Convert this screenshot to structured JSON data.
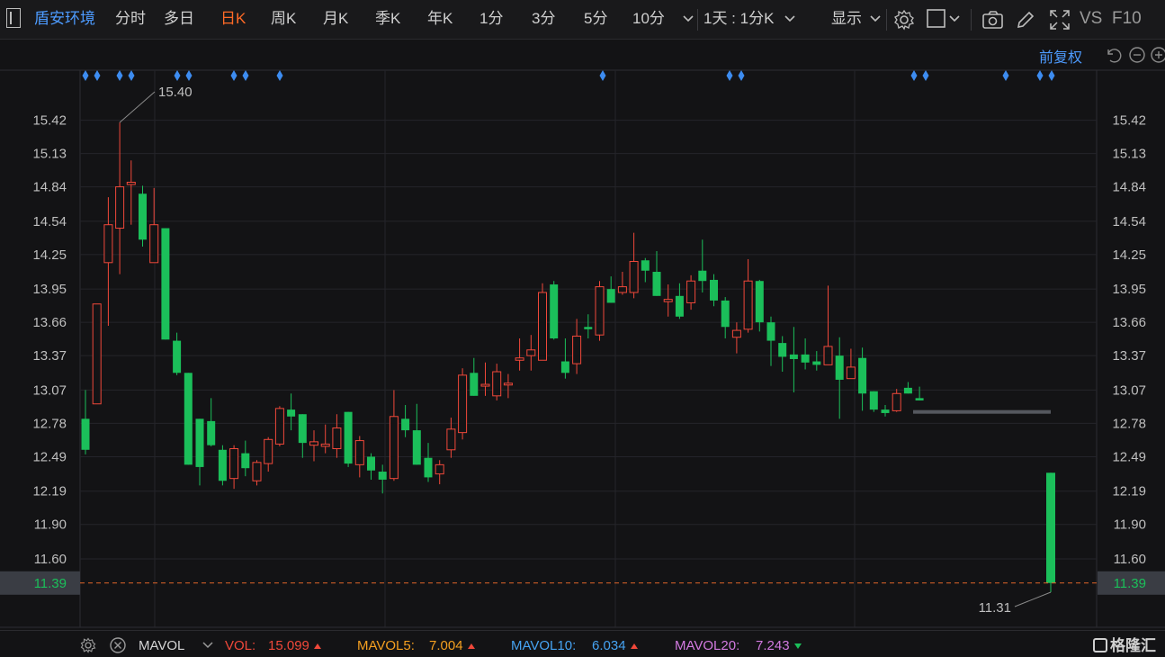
{
  "toolbar": {
    "stock_name": "盾安环境",
    "tabs": [
      "分时",
      "多日",
      "日K",
      "周K",
      "月K",
      "季K",
      "年K",
      "1分",
      "3分",
      "5分",
      "10分"
    ],
    "active_tab": "日K",
    "period_select": "1天 : 1分K",
    "display_label": "显示",
    "vs_label": "VS",
    "f10_label": "F10",
    "adjust_label": "前复权"
  },
  "chart_data": {
    "type": "candlestick",
    "ylim": [
      11.31,
      15.55
    ],
    "yticks": [
      "15.42",
      "15.13",
      "14.84",
      "14.54",
      "14.25",
      "13.95",
      "13.66",
      "13.37",
      "13.07",
      "12.78",
      "12.49",
      "12.19",
      "11.90",
      "11.60"
    ],
    "high_label": "15.40",
    "low_label": "11.31",
    "current_price_label": "11.39",
    "current_price": 11.39,
    "candles": [
      [
        12.82,
        12.55,
        13.07,
        12.51
      ],
      [
        12.95,
        13.82,
        13.82,
        12.95
      ],
      [
        14.18,
        14.51,
        14.75,
        13.63
      ],
      [
        14.48,
        14.84,
        15.4,
        14.08
      ],
      [
        14.86,
        14.88,
        15.07,
        14.51
      ],
      [
        14.78,
        14.38,
        14.85,
        14.32
      ],
      [
        14.18,
        14.51,
        14.83,
        14.18
      ],
      [
        14.48,
        13.51,
        14.48,
        13.51
      ],
      [
        13.5,
        13.22,
        13.57,
        13.2
      ],
      [
        13.22,
        12.42,
        13.22,
        12.42
      ],
      [
        12.82,
        12.4,
        12.82,
        12.24
      ],
      [
        12.8,
        12.59,
        13.0,
        12.58
      ],
      [
        12.55,
        12.28,
        12.59,
        12.24
      ],
      [
        12.3,
        12.56,
        12.59,
        12.21
      ],
      [
        12.52,
        12.39,
        12.63,
        12.32
      ],
      [
        12.28,
        12.44,
        12.46,
        12.24
      ],
      [
        12.43,
        12.64,
        12.66,
        12.36
      ],
      [
        12.6,
        12.91,
        12.93,
        12.58
      ],
      [
        12.9,
        12.84,
        13.04,
        12.72
      ],
      [
        12.86,
        12.61,
        12.86,
        12.48
      ],
      [
        12.59,
        12.62,
        12.72,
        12.45
      ],
      [
        12.58,
        12.6,
        12.77,
        12.52
      ],
      [
        12.56,
        12.74,
        12.86,
        12.48
      ],
      [
        12.88,
        12.43,
        12.88,
        12.4
      ],
      [
        12.42,
        12.63,
        12.67,
        12.31
      ],
      [
        12.49,
        12.37,
        12.52,
        12.29
      ],
      [
        12.36,
        12.29,
        12.42,
        12.17
      ],
      [
        12.3,
        12.84,
        13.07,
        12.28
      ],
      [
        12.82,
        12.72,
        12.94,
        12.66
      ],
      [
        12.72,
        12.42,
        12.95,
        12.42
      ],
      [
        12.48,
        12.31,
        12.61,
        12.27
      ],
      [
        12.34,
        12.42,
        12.46,
        12.25
      ],
      [
        12.55,
        12.73,
        12.83,
        12.48
      ],
      [
        12.7,
        13.2,
        13.26,
        12.64
      ],
      [
        13.22,
        13.02,
        13.35,
        13.02
      ],
      [
        13.12,
        13.12,
        13.31,
        13.02
      ],
      [
        13.02,
        13.23,
        13.3,
        12.98
      ],
      [
        13.12,
        13.13,
        13.21,
        13.0
      ],
      [
        13.33,
        13.35,
        13.52,
        13.24
      ],
      [
        13.37,
        13.42,
        13.55,
        13.24
      ],
      [
        13.33,
        13.92,
        14.0,
        13.34
      ],
      [
        13.99,
        13.52,
        14.02,
        13.51
      ],
      [
        13.32,
        13.22,
        13.52,
        13.17
      ],
      [
        13.3,
        13.54,
        13.69,
        13.21
      ],
      [
        13.62,
        13.6,
        13.73,
        13.52
      ],
      [
        13.55,
        13.97,
        14.02,
        13.5
      ],
      [
        13.95,
        13.83,
        14.06,
        13.83
      ],
      [
        13.92,
        13.97,
        14.1,
        13.9
      ],
      [
        13.92,
        14.19,
        14.44,
        13.87
      ],
      [
        14.2,
        14.11,
        14.22,
        14.01
      ],
      [
        14.1,
        13.89,
        14.28,
        13.89
      ],
      [
        13.84,
        13.86,
        13.99,
        13.71
      ],
      [
        13.89,
        13.71,
        14.0,
        13.69
      ],
      [
        13.83,
        14.02,
        14.07,
        13.77
      ],
      [
        14.11,
        14.02,
        14.38,
        13.92
      ],
      [
        14.03,
        13.85,
        14.08,
        13.8
      ],
      [
        13.85,
        13.62,
        13.88,
        13.52
      ],
      [
        13.53,
        13.59,
        13.66,
        13.39
      ],
      [
        13.6,
        14.02,
        14.21,
        13.57
      ],
      [
        14.02,
        13.66,
        14.03,
        13.58
      ],
      [
        13.66,
        13.5,
        13.71,
        13.28
      ],
      [
        13.48,
        13.36,
        13.54,
        13.23
      ],
      [
        13.38,
        13.34,
        13.62,
        13.05
      ],
      [
        13.38,
        13.31,
        13.52,
        13.25
      ],
      [
        13.32,
        13.29,
        13.41,
        13.24
      ],
      [
        13.29,
        13.45,
        13.98,
        13.42
      ],
      [
        13.37,
        13.16,
        13.53,
        12.82
      ],
      [
        13.17,
        13.27,
        13.43,
        13.17
      ],
      [
        13.35,
        13.04,
        13.44,
        12.89
      ],
      [
        13.06,
        12.9,
        13.06,
        12.88
      ],
      [
        12.9,
        12.87,
        12.94,
        12.84
      ],
      [
        12.89,
        13.04,
        13.08,
        12.88
      ],
      [
        13.09,
        13.04,
        13.14,
        13.04
      ],
      [
        13.0,
        12.98,
        13.1,
        12.98
      ]
    ],
    "volume_legend": {
      "indicator": "MAVOL",
      "vol_label": "VOL:",
      "vol_value": "15.099",
      "mavol5_label": "MAVOL5:",
      "mavol5_value": "7.004",
      "mavol10_label": "MAVOL10:",
      "mavol10_value": "6.034",
      "mavol20_label": "MAVOL20:",
      "mavol20_value": "7.243"
    },
    "colors": {
      "up": "#f0483a",
      "down": "#1bbf5a",
      "grid": "#24242a",
      "text": "#bfbfbf",
      "price_line": "#e0642a",
      "marker": "#3d8cf0"
    }
  },
  "brand": {
    "logo_text": "格隆汇"
  }
}
